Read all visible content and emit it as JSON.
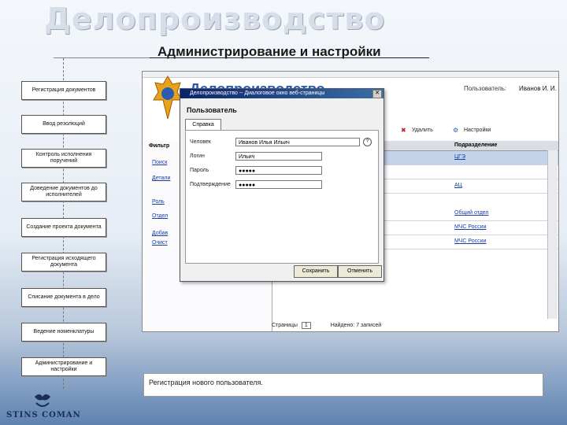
{
  "slide": {
    "title": "Делопроизводство",
    "subtitle": "Администрирование и настройки",
    "caption": "Регистрация нового пользователя.",
    "logo_text": "STINS COMAN"
  },
  "steps": [
    "Регистрация документов",
    "Ввод резолюций",
    "Контроль исполнения поручений",
    "Доведение документов до исполнителей",
    "Создание проекта документа",
    "Регистрация исходящего документа",
    "Списание документа в дело",
    "Ведение номенклатуры",
    "Администрирование и настройки"
  ],
  "app": {
    "brand": "Делопроизводство",
    "user_label": "Пользователь:",
    "user_name": "Иванов И. И.",
    "toolbar": {
      "delete": "Удалить",
      "settings": "Настройки"
    },
    "filter_label": "Фильтр",
    "left_items": [
      "Поиск",
      "Детали",
      "Роль",
      "Отдел"
    ],
    "list_actions": [
      "Добав",
      "Очист"
    ],
    "grid_header": "Подразделение",
    "grid_rows": [
      "ЦГЭ",
      "",
      "АЦ",
      "Общий отдел",
      "МЧС России",
      "МЧС России"
    ],
    "pager": {
      "pages_label": "Страницы",
      "page_value": "1",
      "found_label": "Найдено:",
      "found_value": "7 записей"
    }
  },
  "dialog": {
    "title": "Делопроизводство -- Диалоговое окно веб-страницы",
    "heading": "Пользователь",
    "tab": "Справка",
    "fields": [
      {
        "label": "Человек",
        "value": "Иванов Илья Ильич"
      },
      {
        "label": "Логин",
        "value": "Ильич"
      },
      {
        "label": "Пароль",
        "value": "●●●●●"
      },
      {
        "label": "Подтверждение",
        "value": "●●●●●"
      }
    ],
    "save_button": "Сохранить",
    "cancel_button": "Отменить",
    "close_glyph": "✕",
    "help_glyph": "?"
  }
}
